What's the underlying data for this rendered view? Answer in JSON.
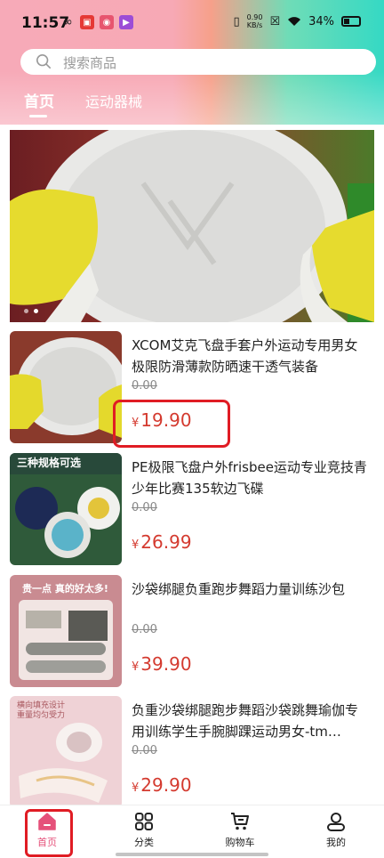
{
  "status_bar": {
    "time": "11:57",
    "net_speed_top": "0.90",
    "net_speed_bottom": "KB/s",
    "battery": "34%"
  },
  "search": {
    "placeholder": "搜索商品",
    "icon": "search-icon"
  },
  "tabs": [
    {
      "label": "首页",
      "active": true
    },
    {
      "label": "运动器械",
      "active": false
    }
  ],
  "banner": {
    "slides": 2,
    "active_slide": 2
  },
  "products": [
    {
      "title": "XCOM艾克飞盘手套户外运动专用男女极限防滑薄款防晒速干透气装备",
      "original_price": "0.00",
      "currency": "¥",
      "price": "19.90"
    },
    {
      "title": "PE极限飞盘户外frisbee运动专业竞技青少年比赛135软边飞碟",
      "original_price": "0.00",
      "currency": "¥",
      "price": "26.99",
      "thumb_text": "三种规格可选"
    },
    {
      "title": "沙袋绑腿负重跑步舞蹈力量训练沙包",
      "original_price": "0.00",
      "currency": "¥",
      "price": "39.90",
      "thumb_text": "贵一点 真的好太多!"
    },
    {
      "title": "负重沙袋绑腿跑步舞蹈沙袋跳舞瑜伽专用训练学生手腕脚踝运动男女-tm…",
      "original_price": "0.00",
      "currency": "¥",
      "price": "29.90",
      "thumb_text": "横向填充设计 重量均匀受力"
    }
  ],
  "bottom_nav": [
    {
      "label": "首页",
      "icon": "home-icon",
      "active": true
    },
    {
      "label": "分类",
      "icon": "category-grid-icon",
      "active": false
    },
    {
      "label": "购物车",
      "icon": "cart-icon",
      "active": false
    },
    {
      "label": "我的",
      "icon": "user-icon",
      "active": false
    }
  ],
  "colors": {
    "price_red": "#d43a2f",
    "active_pink": "#e5517a",
    "highlight_red": "#e01c24"
  }
}
